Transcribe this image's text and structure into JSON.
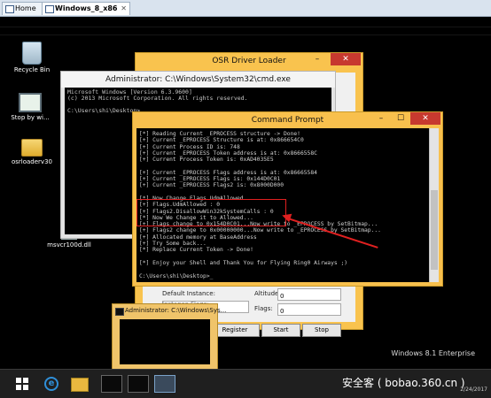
{
  "host_tabs": [
    {
      "label": "Home",
      "active": false
    },
    {
      "label": "Windows_8_x86",
      "active": true
    }
  ],
  "desktop_icons": [
    {
      "label": "Recycle Bin",
      "icon": "recycle-bin-icon"
    },
    {
      "label": "Stop by wi...",
      "icon": "monitor-icon"
    },
    {
      "label": "osrloaderv30",
      "icon": "folder-icon"
    },
    {
      "label": "msvcr100d.dll",
      "icon": "file-icon"
    }
  ],
  "osr_window": {
    "title": "OSR Driver Loader",
    "default_instance_label": "Default Instance:",
    "altitude_label": "Altitude:",
    "altitude_value": "0",
    "instance_flags_label": "Instance Flags:",
    "flags_label": "Flags:",
    "flags_value": "0",
    "buttons": {
      "register": "Register Service",
      "start": "Start Service",
      "stop": "Stop Service"
    }
  },
  "admin_cmd": {
    "title": "Administrator: C:\\Windows\\System32\\cmd.exe",
    "lines": [
      "Microsoft Windows [Version 6.3.9600]",
      "(c) 2013 Microsoft Corporation. All rights reserved.",
      "",
      "C:\\Users\\shi\\Desktop>"
    ]
  },
  "command_prompt": {
    "title": "Command Prompt",
    "lines": [
      "[*] Reading Current _EPROCESS structure -> Done!",
      "[+] Current _EPROCESS Structure is at: 0x866654C0",
      "[+] Current Process ID is: 748",
      "[+] Current _EPROCESS Token address is at: 0x8666558C",
      "[+] Current Process Token is: 0xAD4035E5",
      "",
      "[+] Current _EPROCESS Flags address is at: 0x86665584",
      "[+] Current _EPROCESS Flags is: 0x144D0C01",
      "[+] Current _EPROCESS Flags2 is: 0x8000D000",
      "",
      "[*] Now Change Flags.UdmAllowed...",
      "[+] Flags.UdmAllowed : 0",
      "[+] Flags2.DisallowWin32kSystemCalls : 0",
      "[*] Now We Change it to Allowed...",
      "[+] Flags change to 0x154D0C01...Now write to _EPROCESS by SetBitmap...",
      "[+] Flags2 change to 0x00000000...Now write to _EPROCESS by SetBitmap...",
      "[+] Allocated memory at BaseAddress",
      "[+] Try Some back...",
      "[*] Replace Current Token -> Done!",
      "",
      "[*] Enjoy your Shell and Thank You for Flying Ring0 Airways ;)",
      "",
      "C:\\Users\\shi\\Desktop>_"
    ]
  },
  "taskbar_preview": {
    "title": "Administrator: C:\\Windows\\Sys..."
  },
  "taskbar": {
    "items": [
      "start-button",
      "internet-explorer-icon",
      "file-explorer-icon",
      "cmd-1",
      "cmd-2",
      "cmd-3"
    ]
  },
  "watermark": {
    "os_text": "Windows 8.1 Enterprise",
    "site_text": "安全客 ( bobao.360.cn )",
    "date": "2/24/2017"
  },
  "colors": {
    "accent": "#f8c04d",
    "highlight": "#e02020"
  }
}
